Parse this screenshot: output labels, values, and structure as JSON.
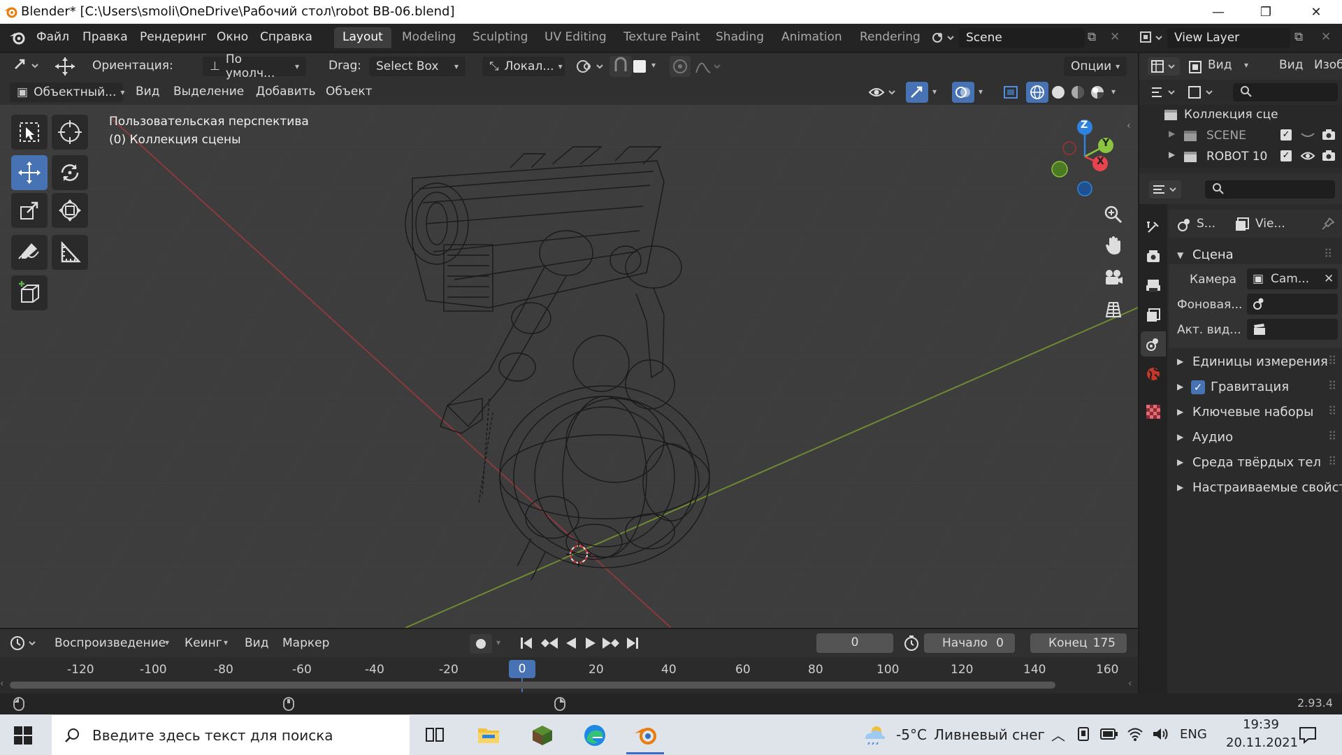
{
  "window": {
    "title": "Blender* [C:\\Users\\smoli\\OneDrive\\Рабочий стол\\robot BB-06.blend]",
    "minimize": "—",
    "maximize": "❐",
    "close": "✕"
  },
  "menubar": {
    "items": [
      "Файл",
      "Правка",
      "Рендеринг",
      "Окно",
      "Справка"
    ],
    "tabs": [
      "Layout",
      "Modeling",
      "Sculpting",
      "UV Editing",
      "Texture Paint",
      "Shading",
      "Animation",
      "Rendering"
    ],
    "active_tab": "Layout",
    "scene": "Scene",
    "view_layer": "View Layer"
  },
  "tool_header": {
    "orientation_label": "Ориентация:",
    "orientation_value": "По умолч...",
    "drag_label": "Drag:",
    "drag_value": "Select Box",
    "pivot_value": "Локал...",
    "options": "Опции"
  },
  "view_header": {
    "mode": "Объектный...",
    "view": "Вид",
    "select": "Выделение",
    "add": "Добавить",
    "object": "Объект"
  },
  "viewport": {
    "perspective": "Пользовательская перспектива",
    "collection": "(0) Коллекция сцены",
    "axes": {
      "z": "Z",
      "y": "Y",
      "x": "X"
    }
  },
  "outliner": {
    "view_label": "Вид",
    "view_label2": "Вид",
    "image_label": "Изоб",
    "root": "Коллекция сце",
    "items": [
      {
        "name": "SCENE"
      },
      {
        "name": "ROBOT 10"
      }
    ]
  },
  "properties": {
    "scene_tab": "S...",
    "view_tab": "Vie...",
    "section": "Сцена",
    "camera_label": "Камера",
    "camera_value": "Cam...",
    "background_label": "Фоновая...",
    "active_clip_label": "Акт. вид...",
    "subsections": [
      "Единицы измерения",
      "Гравитация",
      "Ключевые наборы",
      "Аудио",
      "Среда твёрдых тел",
      "Настраиваемые свойст"
    ],
    "gravity_checked": true
  },
  "timeline": {
    "playback": "Воспроизведение",
    "keying": "Кеинг",
    "view": "Вид",
    "marker": "Маркер",
    "current_frame": "0",
    "start_label": "Начало",
    "start_value": "0",
    "end_label": "Конец",
    "end_value": "175",
    "ruler": [
      "-120",
      "-100",
      "-80",
      "-60",
      "-40",
      "-20",
      "0",
      "20",
      "40",
      "60",
      "80",
      "100",
      "120",
      "140",
      "160"
    ]
  },
  "statusbar": {
    "version": "2.93.4"
  },
  "taskbar": {
    "search_placeholder": "Введите здесь текст для поиска",
    "weather_temp": "-5°C",
    "weather_desc": "Ливневый снег",
    "lang": "ENG",
    "time": "19:39",
    "date": "20.11.2021"
  },
  "colors": {
    "accent": "#4772b3",
    "x_axis": "#e8434f",
    "y_axis": "#8bc43f",
    "z_axis": "#2f83e0"
  }
}
